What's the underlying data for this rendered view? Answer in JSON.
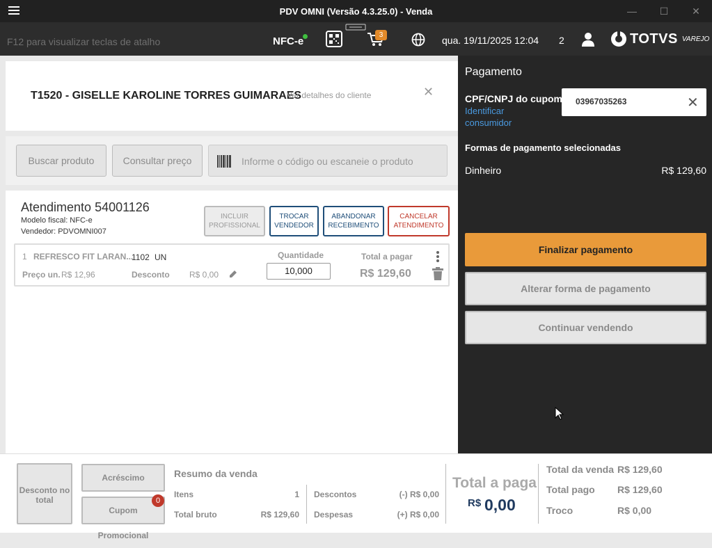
{
  "window": {
    "title": "PDV OMNI (Versão 4.3.25.0) - Venda"
  },
  "header": {
    "hint": "F12 para visualizar teclas de atalho",
    "fiscal_mode": "NFC-e",
    "cart_count": "3",
    "datetime": "qua. 19/11/2025 12:04",
    "user_count": "2",
    "brand": "TOTVS",
    "brand_sub": "VAREJO"
  },
  "client": {
    "name": "T1520 - GISELLE KAROLINE TORRES GUIMARAES",
    "details_link": "Ver detalhes do cliente"
  },
  "search": {
    "buscar_label": "Buscar produto",
    "consultar_label": "Consultar preço",
    "scan_placeholder": "Informe o código ou escaneie o produto"
  },
  "sale": {
    "title": "Atendimento 54001126",
    "modelo": "Modelo fiscal: NFC-e",
    "vendedor": "Vendedor: PDVOMNI007",
    "btn_incluir": "INCLUIR PROFISSIONAL",
    "btn_trocar": "TROCAR VENDEDOR",
    "btn_abandonar": "ABANDONAR RECEBIMENTO",
    "btn_cancelar": "CANCELAR ATENDIMENTO",
    "item": {
      "index": "1",
      "name": "REFRESCO FIT LARAN...",
      "code": "1102",
      "unit": "UN",
      "price_label": "Preço un.",
      "price": "R$ 12,96",
      "discount_label": "Desconto",
      "discount": "R$ 0,00",
      "qty_label": "Quantidade",
      "qty": "10,000",
      "total_label": "Total a pagar",
      "total": "R$ 129,60"
    }
  },
  "payment": {
    "title": "Pagamento",
    "cpf_label": "CPF/CNPJ do cupom",
    "identify_link": "Identificar consumidor",
    "cpf_value": "03967035263",
    "methods_title": "Formas de pagamento selecionadas",
    "method_name": "Dinheiro",
    "method_value": "R$ 129,60",
    "finalize": "Finalizar pagamento",
    "change_method": "Alterar forma de pagamento",
    "continue": "Continuar vendendo"
  },
  "footer": {
    "desconto_total": "Desconto no total",
    "acrescimo": "Acréscimo",
    "cupom": "Cupom Promocional",
    "cupom_badge": "0",
    "resumo": "Resumo da venda",
    "itens_label": "Itens",
    "itens_val": "1",
    "bruto_label": "Total bruto",
    "bruto_val": "R$ 129,60",
    "descontos_label": "Descontos",
    "descontos_val": "(-) R$ 0,00",
    "despesas_label": "Despesas",
    "despesas_val": "(+) R$ 0,00",
    "total_pagar_label": "Total a paga",
    "total_currency": "R$",
    "total_pagar_val": "0,00",
    "total_venda_label": "Total da venda",
    "total_venda_val": "R$ 129,60",
    "total_pago_label": "Total pago",
    "total_pago_val": "R$ 129,60",
    "troco_label": "Troco",
    "troco_val": "R$ 0,00"
  },
  "colors": {
    "accent_orange": "#e99a3a",
    "link_blue": "#4a9ae0",
    "cancel_red": "#c0392b",
    "panel_dark": "#262626"
  }
}
